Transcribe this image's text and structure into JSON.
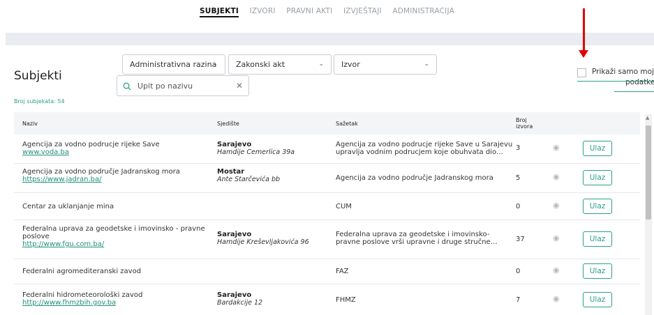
{
  "nav": {
    "items": [
      {
        "label": "SUBJEKTI",
        "active": true
      },
      {
        "label": "IZVORI",
        "active": false
      },
      {
        "label": "PRAVNI AKTI",
        "active": false
      },
      {
        "label": "IZVJEŠTAJI",
        "active": false
      },
      {
        "label": "ADMINISTRACIJA",
        "active": false
      }
    ]
  },
  "page": {
    "title": "Subjekti",
    "count": "Broj subjekata: 54"
  },
  "filters": {
    "level": "Administrativna razina",
    "law": "Zakonski akt",
    "source": "Izvor",
    "search_placeholder": "Upit po nazivu"
  },
  "mine_checkbox": {
    "label_line1": "Prikaži samo moje",
    "label_line2": "podatke",
    "checked": false
  },
  "table": {
    "headers": {
      "name": "Naziv",
      "seat": "Sjedište",
      "summary": "Sažetak",
      "count_line1": "Broj",
      "count_line2": "izvora"
    },
    "rows": [
      {
        "name": "Agencija za vodno podrucje rijeke Save",
        "url": "www.voda.ba",
        "city": "Sarajevo",
        "address": "Hamdije Cemerlica 39a",
        "summary1": "Agencija za vodno podrucje rijeke Save u Sarajevu",
        "summary2": "upravlja vodnim podrucjem koje obuhvata dio…",
        "count": "3",
        "btn": "Ulaz"
      },
      {
        "name": "Agencija za vodno područje Jadranskog mora",
        "url": "https://www.jadran.ba/",
        "city": "Mostar",
        "address": "Ante Starčevića bb",
        "summary1": "Agencija za vodno područje Jadranskog mora",
        "summary2": "",
        "count": "5",
        "btn": "Ulaz"
      },
      {
        "name": "Centar za uklanjanje mina",
        "url": "",
        "city": "",
        "address": "",
        "summary1": "CUM",
        "summary2": "",
        "count": "0",
        "btn": "Ulaz"
      },
      {
        "name": "Federalna uprava za geodetske i imovinsko - pravne",
        "name2": "poslove",
        "url": "http://www.fgu.com.ba/",
        "city": "Sarajevo",
        "address": "Hamdije Kreševljakovića 96",
        "summary1": "Federalna uprava za geodetske i imovinsko-",
        "summary2": "pravne poslove vrši upravne i druge stručne…",
        "count": "37",
        "btn": "Ulaz"
      },
      {
        "name": "Federalni agromediteranski zavod",
        "url": "",
        "city": "",
        "address": "",
        "summary1": "FAZ",
        "summary2": "",
        "count": "0",
        "btn": "Ulaz"
      },
      {
        "name": "Federalni hidrometeorološki zavod",
        "url": "http://www.fhmzbih.gov.ba",
        "city": "Sarajevo",
        "address": "Bardakcije 12",
        "summary1": "FHMZ",
        "summary2": "",
        "count": "7",
        "btn": "Ulaz"
      }
    ]
  },
  "colors": {
    "accent": "#2aa089",
    "arrow": "#e10000"
  },
  "icons": {
    "search": "search-icon",
    "clear": "close-icon",
    "eye": "eye-icon",
    "chevron": "chevron-down-icon"
  }
}
